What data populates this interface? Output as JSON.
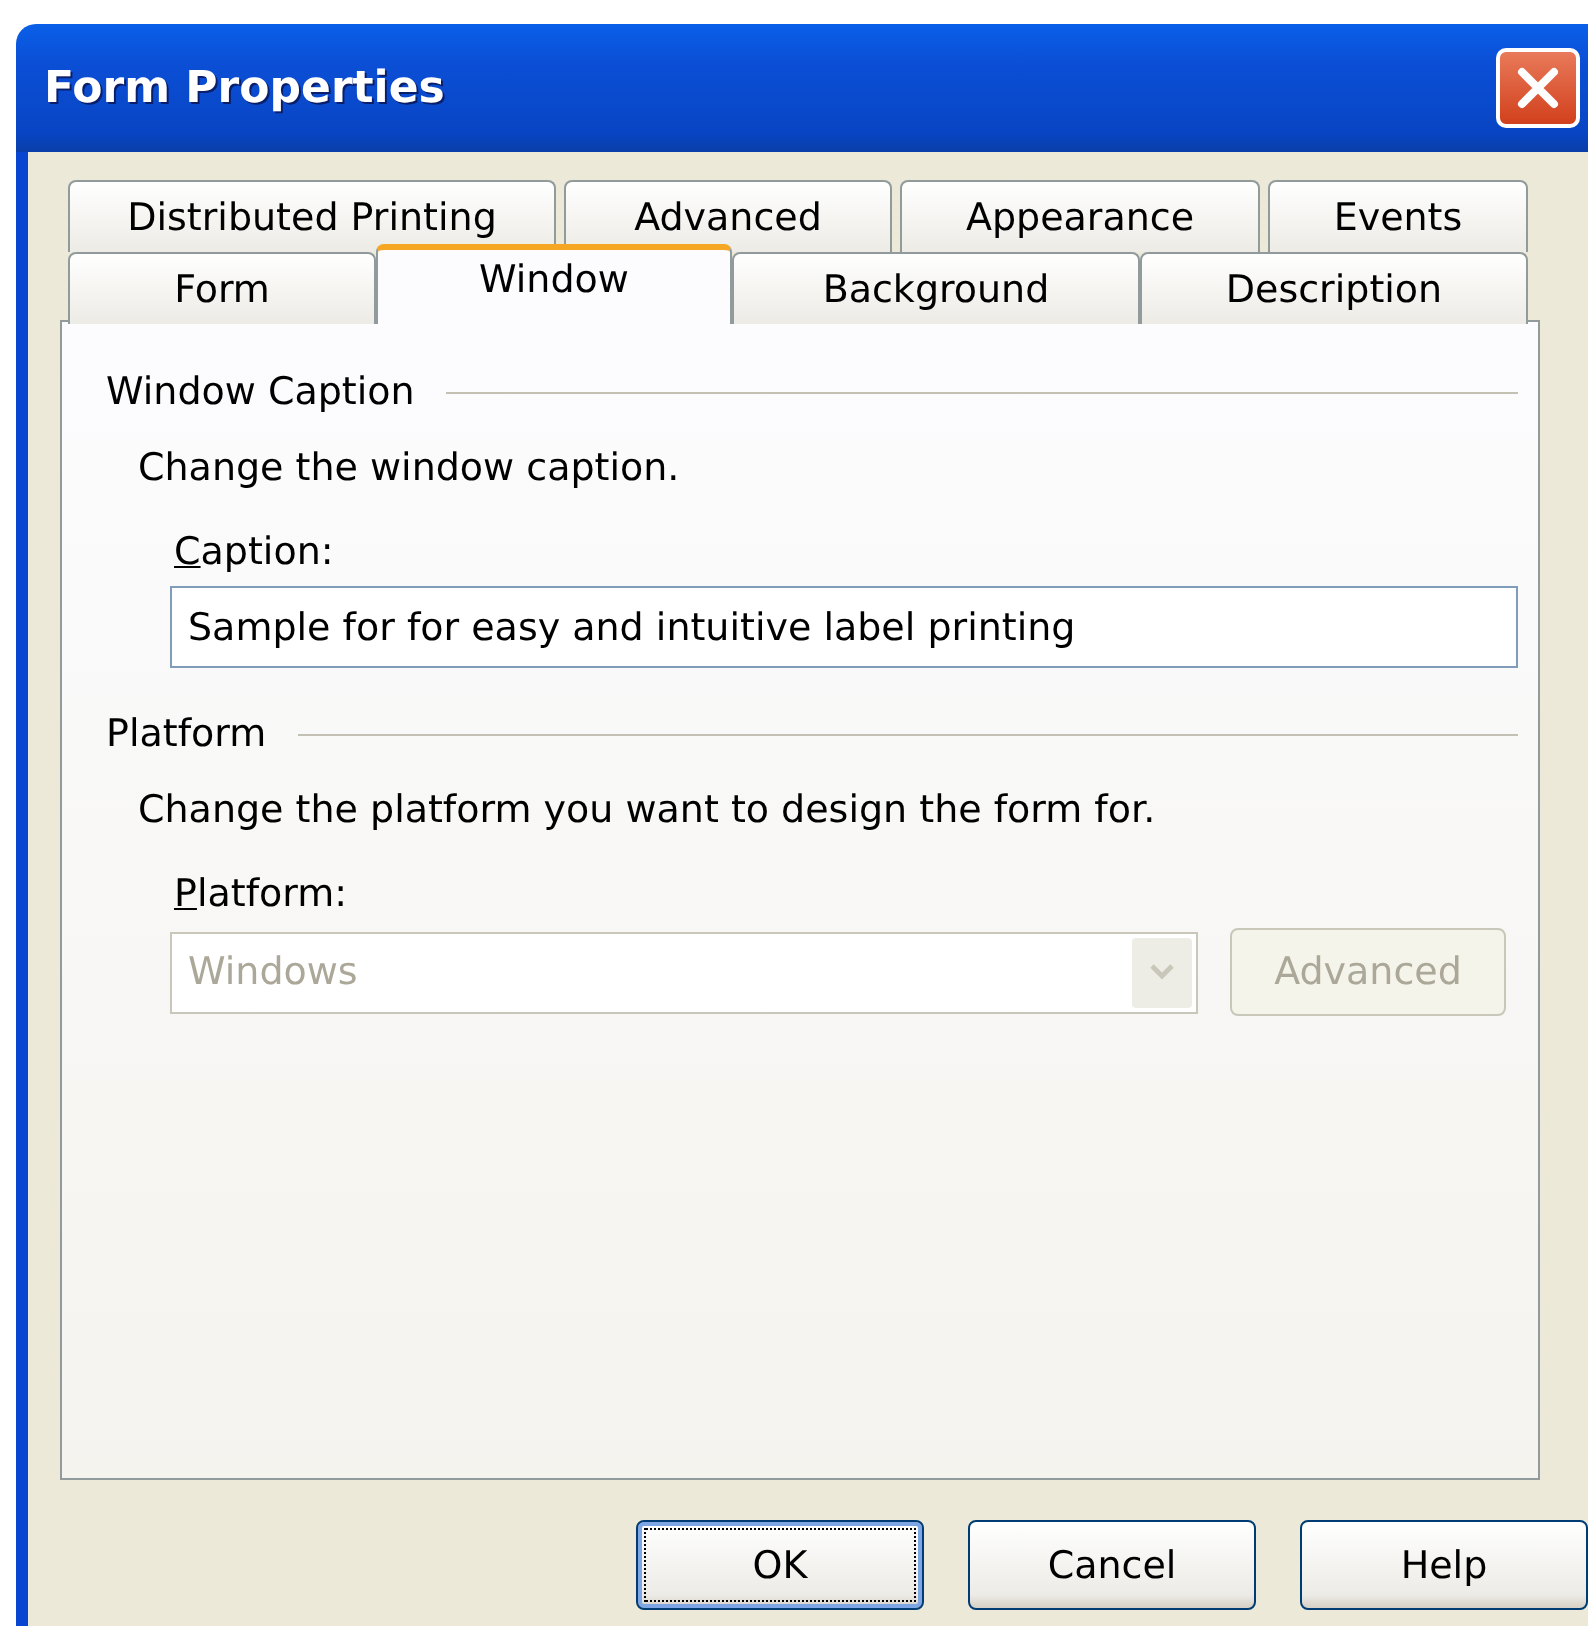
{
  "window": {
    "title": "Form Properties"
  },
  "tab_rows": [
    {
      "tabs": [
        {
          "label": "Distributed Printing",
          "selected": false
        },
        {
          "label": "Advanced",
          "selected": false
        },
        {
          "label": "Appearance",
          "selected": false
        },
        {
          "label": "Events",
          "selected": false
        }
      ]
    },
    {
      "tabs": [
        {
          "label": "Form",
          "selected": false
        },
        {
          "label": "Window",
          "selected": true
        },
        {
          "label": "Background",
          "selected": false
        },
        {
          "label": "Description",
          "selected": false
        }
      ]
    }
  ],
  "sections": [
    {
      "heading": "Window Caption",
      "description": "Change the window caption.",
      "field": {
        "kind": "text",
        "label": "Caption:",
        "value": "Sample for for easy and intuitive label printing",
        "disabled": false
      }
    },
    {
      "heading": "Platform",
      "description": "Change the platform you want to design the form for.",
      "field": {
        "kind": "dropdown",
        "label": "Platform:",
        "value": "Windows",
        "disabled": true,
        "button": {
          "label": "Advanced",
          "disabled": true
        }
      }
    }
  ],
  "buttons": [
    {
      "label": "OK",
      "focused": true
    },
    {
      "label": "Cancel",
      "focused": false
    },
    {
      "label": "Help",
      "focused": false
    }
  ]
}
